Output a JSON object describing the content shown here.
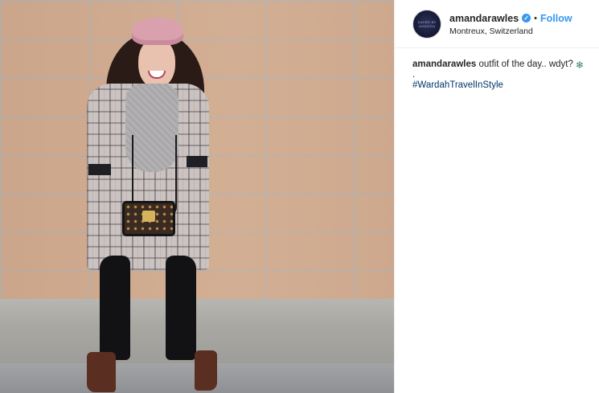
{
  "post": {
    "avatar_text": "SAVED BY AMANDA",
    "username": "amandarawles",
    "verified_icon": "verified-badge-icon",
    "separator": "•",
    "follow_label": "Follow",
    "location": "Montreux, Switzerland"
  },
  "caption": {
    "username": "amandarawles",
    "text": "outfit of the day.. wdyt?",
    "emoji_icon": "snowflake-icon",
    "emoji": "❄",
    "dot": ".",
    "hashtag": "#WardahTravelInStyle"
  },
  "colors": {
    "accent": "#3897f0",
    "hashtag": "#003569",
    "text": "#262626"
  }
}
